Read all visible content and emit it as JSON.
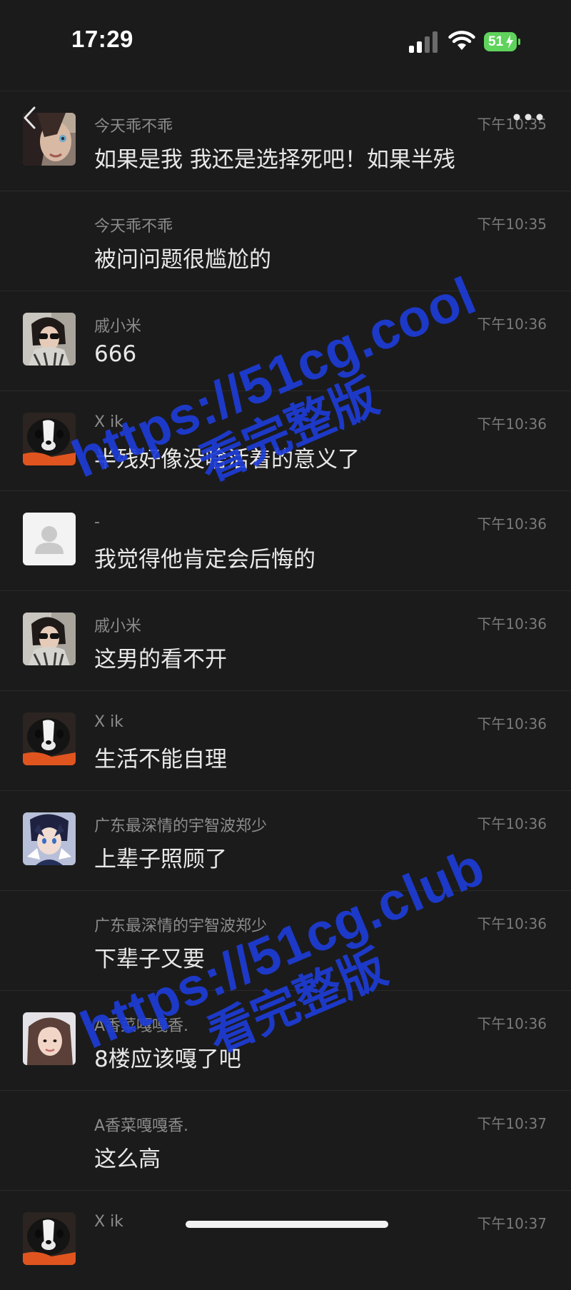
{
  "status_bar": {
    "time": "17:29",
    "battery_level": "51"
  },
  "messages": [
    {
      "sender": "今天乖不乖",
      "text": "如果是我 我还是选择死吧！如果半残",
      "time": "下午10:35",
      "avatar": "girl-eye-photo"
    },
    {
      "sender": "今天乖不乖",
      "text": "被问问题很尴尬的",
      "time": "下午10:35",
      "avatar": ""
    },
    {
      "sender": "戚小米",
      "text": "666",
      "time": "下午10:36",
      "avatar": "girl-sunglasses-photo"
    },
    {
      "sender": "X ik",
      "text": "半残好像没啥活着的意义了",
      "time": "下午10:36",
      "avatar": "black-white-dog-photo"
    },
    {
      "sender": "-",
      "text": "我觉得他肯定会后悔的",
      "time": "下午10:36",
      "avatar": "default-user-icon"
    },
    {
      "sender": "戚小米",
      "text": "这男的看不开",
      "time": "下午10:36",
      "avatar": "girl-sunglasses-photo"
    },
    {
      "sender": "X ik",
      "text": "生活不能自理",
      "time": "下午10:36",
      "avatar": "black-white-dog-photo"
    },
    {
      "sender": "广东最深情的宇智波郑少",
      "text": "上辈子照顾了",
      "time": "下午10:36",
      "avatar": "anime-character-photo"
    },
    {
      "sender": "广东最深情的宇智波郑少",
      "text": "下辈子又要",
      "time": "下午10:36",
      "avatar": ""
    },
    {
      "sender": "A香菜嘎嘎香.",
      "text": "8楼应该嘎了吧",
      "time": "下午10:36",
      "avatar": "girl-selfie-photo"
    },
    {
      "sender": "A香菜嘎嘎香.",
      "text": "这么高",
      "time": "下午10:37",
      "avatar": ""
    },
    {
      "sender": "X ik",
      "text": "",
      "time": "下午10:37",
      "avatar": "black-white-dog-photo"
    }
  ],
  "watermarks": [
    {
      "url": "https://51cg.cool",
      "label": "看完整版"
    },
    {
      "url": "https://51cg.club",
      "label": "看完整版"
    }
  ],
  "colors": {
    "background": "#1b1b1b",
    "watermark": "#1e3cd6",
    "battery": "#5fd35b"
  }
}
